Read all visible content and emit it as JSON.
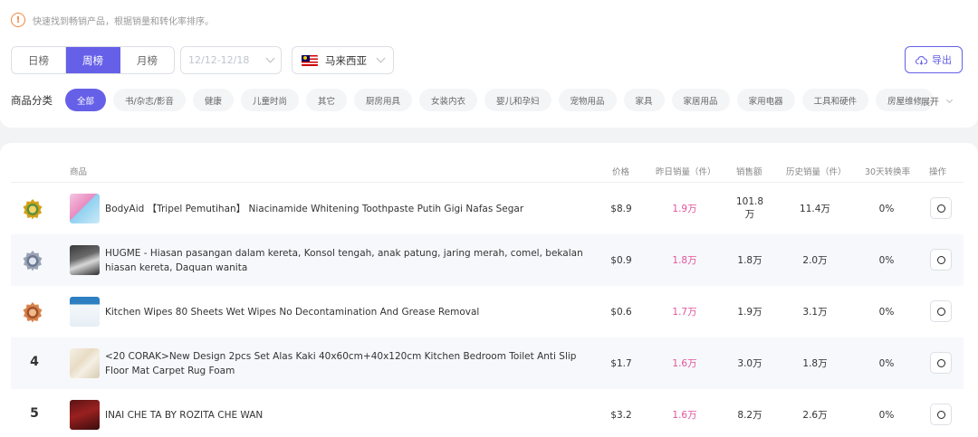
{
  "notice": {
    "text": "快速找到畅销产品，根据销量和转化率排序。"
  },
  "period_tabs": [
    {
      "label": "日榜",
      "active": false
    },
    {
      "label": "周榜",
      "active": true
    },
    {
      "label": "月榜",
      "active": false
    }
  ],
  "date_range": {
    "value": "12/12-12/18"
  },
  "country": {
    "label": "马来西亚",
    "flag": "malaysia-flag"
  },
  "export_button": {
    "label": "导出",
    "icon": "cloud-download-icon"
  },
  "categories": {
    "label": "商品分类",
    "items": [
      "全部",
      "书/杂志/影音",
      "健康",
      "儿童时尚",
      "其它",
      "厨房用具",
      "女装内衣",
      "婴儿和孕妇",
      "宠物用品",
      "家具",
      "家居用品",
      "家用电器",
      "工具和硬件",
      "房屋维修"
    ],
    "active_index": 0,
    "expand_label": "展开"
  },
  "table": {
    "columns": [
      "商品",
      "价格",
      "昨日销量（件）",
      "销售额",
      "历史销量（件）",
      "30天转换率",
      "操作"
    ],
    "rows": [
      {
        "rank": "1",
        "name": "BodyAid 【Tripel Pemutihan】 Niacinamide Whitening Toothpaste Putih Gigi Nafas Segar",
        "price": "$8.9",
        "yesterday_sales": "1.9万",
        "revenue": "101.8万",
        "total_sales": "11.4万",
        "conversion": "0%"
      },
      {
        "rank": "2",
        "name": "HUGME - Hiasan pasangan dalam kereta, Konsol tengah, anak patung, jaring merah, comel, bekalan hiasan kereta, Daquan wanita",
        "price": "$0.9",
        "yesterday_sales": "1.8万",
        "revenue": "1.8万",
        "total_sales": "2.0万",
        "conversion": "0%"
      },
      {
        "rank": "3",
        "name": "Kitchen Wipes 80 Sheets Wet Wipes No Decontamination And Grease Removal",
        "price": "$0.6",
        "yesterday_sales": "1.7万",
        "revenue": "1.9万",
        "total_sales": "3.1万",
        "conversion": "0%"
      },
      {
        "rank": "4",
        "name": "<20 CORAK>New Design 2pcs Set Alas Kaki 40x60cm+40x120cm Kitchen Bedroom Toilet Anti Slip Floor Mat Carpet Rug Foam",
        "price": "$1.7",
        "yesterday_sales": "1.6万",
        "revenue": "3.0万",
        "total_sales": "1.8万",
        "conversion": "0%"
      },
      {
        "rank": "5",
        "name": "INAI CHE TA BY ROZITA CHE WAN",
        "price": "$3.2",
        "yesterday_sales": "1.6万",
        "revenue": "8.2万",
        "total_sales": "2.6万",
        "conversion": "0%"
      }
    ]
  },
  "colors": {
    "accent": "#6660e8",
    "sales_pink": "#e0559d",
    "gold": "#d4a017",
    "silver": "#9aa3b5",
    "bronze": "#d9824a"
  }
}
